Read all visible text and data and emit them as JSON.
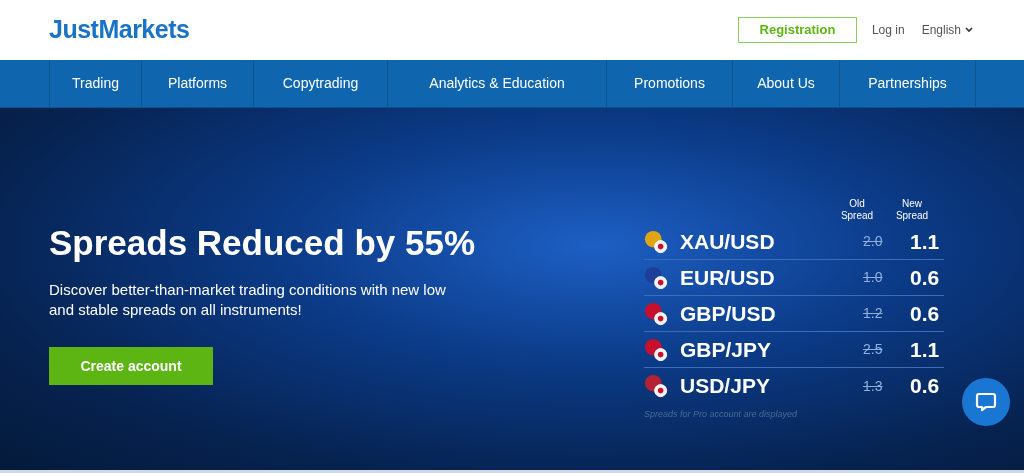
{
  "header": {
    "logo": "JustMarkets",
    "register": "Registration",
    "login": "Log in",
    "language": "English"
  },
  "nav": [
    "Trading",
    "Platforms",
    "Copytrading",
    "Analytics & Education",
    "Promotions",
    "About Us",
    "Partnerships"
  ],
  "hero": {
    "title": "Spreads Reduced by 55%",
    "subtitle": "Discover better-than-market trading conditions with new low and stable spreads on all instruments!",
    "cta": "Create account"
  },
  "spreads": {
    "old_header": "Old Spread",
    "new_header": "New Spread",
    "rows": [
      {
        "pair": "XAU/USD",
        "old": "2.0",
        "new": "1.1",
        "color": "#e0a515"
      },
      {
        "pair": "EUR/USD",
        "old": "1.0",
        "new": "0.6",
        "color": "#1d3f9a"
      },
      {
        "pair": "GBP/USD",
        "old": "1.2",
        "new": "0.6",
        "color": "#c8102e"
      },
      {
        "pair": "GBP/JPY",
        "old": "2.5",
        "new": "1.1",
        "color": "#c8102e"
      },
      {
        "pair": "USD/JPY",
        "old": "1.3",
        "new": "0.6",
        "color": "#b22234"
      }
    ],
    "note": "Spreads for Pro account are displayed"
  }
}
